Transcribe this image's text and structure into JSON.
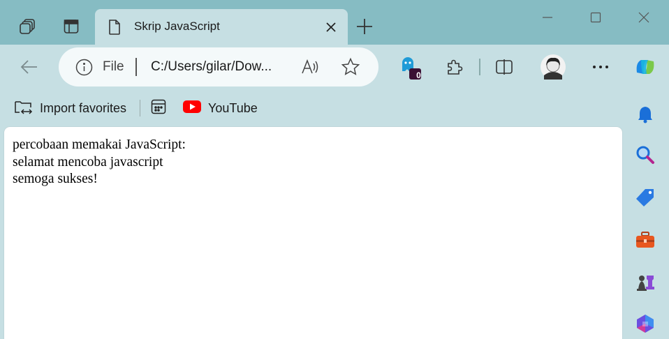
{
  "tab": {
    "title": "Skrip JavaScript"
  },
  "address": {
    "scheme_label": "File",
    "url": "C:/Users/gilar/Dow..."
  },
  "extensions": {
    "badge_count": "0"
  },
  "favorites": [
    {
      "label": "Import favorites"
    },
    {
      "label": "YouTube"
    }
  ],
  "page": {
    "lines": [
      "percobaan memakai JavaScript:",
      "selamat mencoba javascript",
      "semoga sukses!"
    ]
  },
  "colors": {
    "titlebar": "#86bcc3",
    "toolbar": "#c6dfe3",
    "youtube": "#ff0000"
  }
}
